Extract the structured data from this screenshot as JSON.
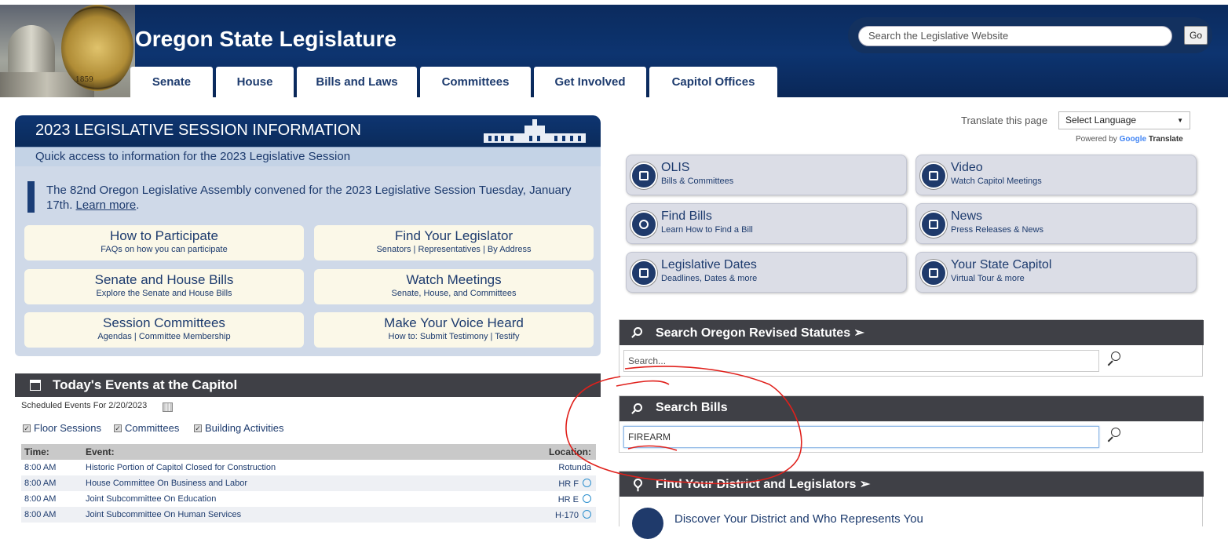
{
  "site": {
    "title": "Oregon State Legislature",
    "seal_year": "1859",
    "search_placeholder": "Search the Legislative Website",
    "go_label": "Go"
  },
  "nav": {
    "tabs": [
      "Senate",
      "House",
      "Bills and Laws",
      "Committees",
      "Get Involved",
      "Capitol Offices"
    ]
  },
  "session": {
    "title": "2023 LEGISLATIVE SESSION INFORMATION",
    "subtitle": "Quick access to information for the 2023 Legislative Session",
    "desc": "The 82nd Oregon Legislative Assembly convened for the 2023 Legislative Session Tuesday, January 17th.",
    "learn_more": "Learn more",
    "buttons": [
      {
        "title": "How to Participate",
        "sub": "FAQs on how you can participate"
      },
      {
        "title": "Find Your Legislator",
        "sub": "Senators | Representatives | By Address"
      },
      {
        "title": "Senate and House Bills",
        "sub": "Explore the Senate and House Bills"
      },
      {
        "title": "Watch Meetings",
        "sub": "Senate, House, and Committees"
      },
      {
        "title": "Session Committees",
        "sub": "Agendas | Committee Membership"
      },
      {
        "title": "Make Your Voice Heard",
        "sub": "How to: Submit Testimony | Testify"
      }
    ]
  },
  "events": {
    "title": "Today's Events at the Capitol",
    "scheduled": "Scheduled Events For 2/20/2023",
    "filters": [
      "Floor Sessions",
      "Committees",
      "Building Activities"
    ],
    "columns": {
      "time": "Time:",
      "event": "Event:",
      "location": "Location:"
    },
    "rows": [
      {
        "time": "8:00 AM",
        "event": "Historic Portion of Capitol Closed for Construction",
        "location": "Rotunda",
        "icon": false
      },
      {
        "time": "8:00 AM",
        "event": "House Committee On Business and Labor",
        "location": "HR F",
        "icon": true
      },
      {
        "time": "8:00 AM",
        "event": "Joint Subcommittee On Education",
        "location": "HR E",
        "icon": true
      },
      {
        "time": "8:00 AM",
        "event": "Joint Subcommittee On Human Services",
        "location": "H-170",
        "icon": true
      }
    ]
  },
  "translate": {
    "label": "Translate this page",
    "select": "Select Language",
    "powered_prefix": "Powered by",
    "google": "Google",
    "translate_word": "Translate"
  },
  "quicklinks": [
    {
      "title": "OLIS",
      "sub": "Bills & Committees"
    },
    {
      "title": "Video",
      "sub": "Watch Capitol Meetings"
    },
    {
      "title": "Find Bills",
      "sub": "Learn How to Find a Bill"
    },
    {
      "title": "News",
      "sub": "Press Releases & News"
    },
    {
      "title": "Legislative Dates",
      "sub": "Deadlines, Dates & more"
    },
    {
      "title": "Your State Capitol",
      "sub": "Virtual Tour & more"
    }
  ],
  "search_ors": {
    "title": "Search Oregon Revised Statutes ➢",
    "placeholder": "Search..."
  },
  "search_bills": {
    "title": "Search Bills",
    "value": "FIREARM"
  },
  "district": {
    "title": "Find Your District and Legislators ➢",
    "desc": "Discover Your District and Who Represents You"
  },
  "colors": {
    "navy": "#0d3470",
    "panel": "#cfd9e8",
    "bar": "#3f4046",
    "annotation": "#e0201b"
  }
}
